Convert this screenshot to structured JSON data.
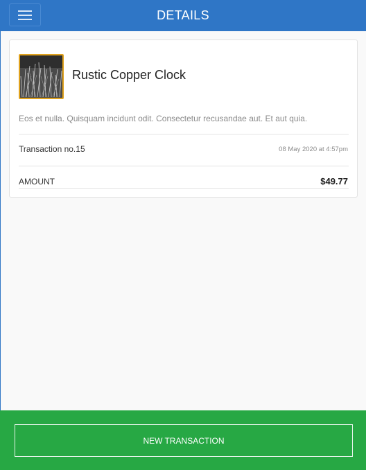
{
  "header": {
    "title": "DETAILS",
    "menu_icon": "hamburger-menu-icon",
    "color": "#2f76c6"
  },
  "item": {
    "title": "Rustic Copper Clock",
    "description": "Eos et nulla. Quisquam incidunt odit. Consectetur recusandae aut. Et aut quia.",
    "transaction": "Transaction no.15",
    "date": "08 May 2020 at 4:57pm",
    "amount_label": "AMOUNT",
    "amount_value": "$49.77",
    "thumbnail_border": "#e0a21d"
  },
  "footer": {
    "button_label": "NEW TRANSACTION",
    "color": "#27a844"
  }
}
